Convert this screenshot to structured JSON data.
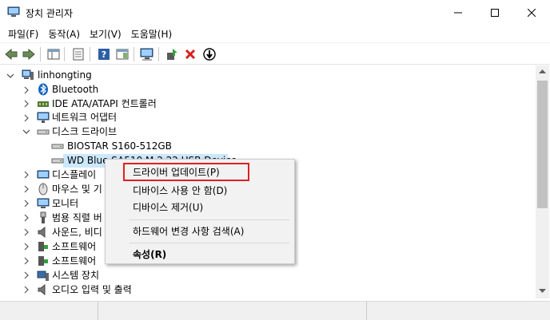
{
  "window": {
    "title": "장치 관리자",
    "buttons": [
      "minimize",
      "maximize",
      "close"
    ]
  },
  "menubar": {
    "items": [
      "파일(F)",
      "동작(A)",
      "보기(V)",
      "도움말(H)"
    ]
  },
  "toolbar": {
    "icons": [
      "back-icon",
      "forward-icon",
      "show-hide-tree-icon",
      "properties-icon",
      "help-icon",
      "action-pane-icon",
      "scan-hardware-icon",
      "update-driver-icon",
      "uninstall-icon",
      "disable-icon"
    ]
  },
  "tree": {
    "root": "linhongting",
    "categories": [
      {
        "label": "Bluetooth",
        "icon": "bluetooth-icon"
      },
      {
        "label": "IDE ATA/ATAPI 컨트롤러",
        "icon": "ide-controller-icon"
      },
      {
        "label": "네트워크 어댑터",
        "icon": "network-adapter-icon"
      },
      {
        "label": "디스크 드라이브",
        "icon": "disk-drive-icon",
        "expanded": true,
        "children": [
          "BIOSTAR S160-512GB",
          "WD Blue SA510 M.2 22 USB Device"
        ]
      },
      {
        "label": "디스플레이 어댑터",
        "icon": "display-adapter-icon"
      },
      {
        "label": "마우스 및 기타 포인팅 장치",
        "icon": "mouse-icon"
      },
      {
        "label": "모니터",
        "icon": "monitor-icon"
      },
      {
        "label": "범용 직렬 버스 컨트롤러",
        "icon": "usb-icon"
      },
      {
        "label": "사운드, 비디오 및 게임 컨트롤러",
        "icon": "speaker-icon"
      },
      {
        "label": "소프트웨어 구성 요소",
        "icon": "software-component-icon"
      },
      {
        "label": "소프트웨어 장치",
        "icon": "software-device-icon"
      },
      {
        "label": "시스템 장치",
        "icon": "system-device-icon"
      },
      {
        "label": "오디오 입력 및 출력",
        "icon": "audio-io-icon"
      }
    ],
    "visible_labels": {
      "display": "디스플레이",
      "mouse": "마우스 및 기",
      "usb": "범용 직렬 버",
      "sound": "사운드, 비디",
      "software_component": "소프트웨어",
      "software_device": "소프트웨어"
    }
  },
  "context_menu": {
    "items": [
      {
        "label": "드라이버 업데이트(P)",
        "highlighted": true
      },
      {
        "label": "디바이스 사용 안 함(D)"
      },
      {
        "label": "디바이스 제거(U)"
      },
      {
        "label": "하드웨어 변경 사항 검색(A)"
      },
      {
        "label": "속성(R)",
        "bold": true
      }
    ],
    "highlight_color": "#e02020"
  },
  "colors": {
    "selection": "#cce8ff",
    "highlight_box": "#e02020"
  }
}
